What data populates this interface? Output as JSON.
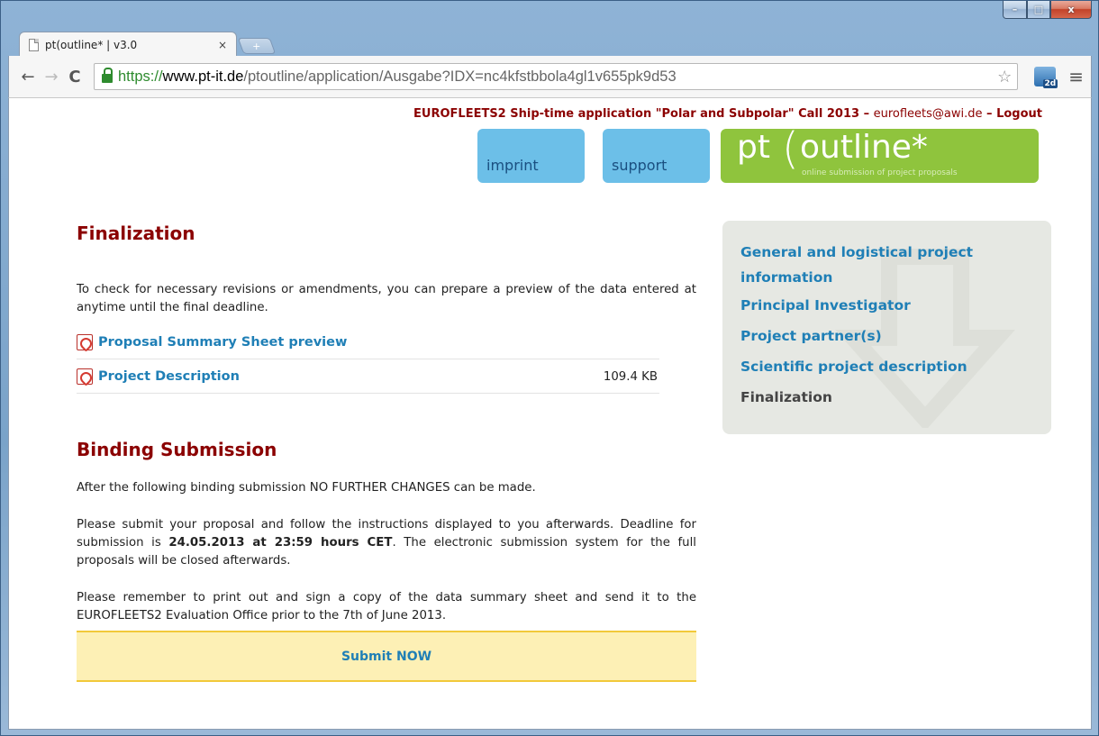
{
  "browser": {
    "tab_title": "pt(outline* | v3.0",
    "tab_close": "×",
    "new_tab": "+",
    "url_scheme": "https://",
    "url_host": "www.pt-it.de",
    "url_path": "/ptoutline/application/Ausgabe?IDX=nc4kfstbbola4gl1v655pk9d53",
    "ext_badge": "2d",
    "window_controls": {
      "minimize": "–",
      "maximize": "□",
      "close": "x"
    }
  },
  "header": {
    "call_title": "EUROFLEETS2 Ship-time application \"Polar and Subpolar\" Call 2013",
    "separator1": " – ",
    "email": "eurofleets@awi.de",
    "separator2": " – ",
    "logout": "Logout",
    "imprint": "imprint",
    "support": "support",
    "logo_pt": "pt",
    "logo_paren": "(",
    "logo_outline": "outline*",
    "logo_tagline": "online submission of project proposals"
  },
  "finalization": {
    "heading": "Finalization",
    "intro": "To check for necessary revisions or amendments, you can prepare a preview of the data entered at anytime until the final deadline.",
    "files": [
      {
        "label": "Proposal Summary Sheet preview",
        "size": ""
      },
      {
        "label": "Project Description",
        "size": "109.4 KB"
      }
    ]
  },
  "binding": {
    "heading": "Binding Submission",
    "p1": "After the following binding submission NO FURTHER CHANGES can be made.",
    "p2_a": "Please submit your proposal and follow the instructions displayed to you afterwards. Deadline for submission is ",
    "p2_deadline": "24.05.2013 at 23:59 hours CET",
    "p2_b": ". The electronic submission system for the full proposals will be closed afterwards.",
    "p3": "Please remember to print out and sign a copy of the data summary sheet and send it to the EUROFLEETS2 Evaluation Office prior to the 7th of June 2013.",
    "submit": "Submit NOW"
  },
  "sidebar": {
    "items": [
      {
        "label": "General and logistical project information"
      },
      {
        "label": "Principal Investigator"
      },
      {
        "label": "Project partner(s)"
      },
      {
        "label": "Scientific project description"
      },
      {
        "label": "Finalization"
      }
    ]
  }
}
